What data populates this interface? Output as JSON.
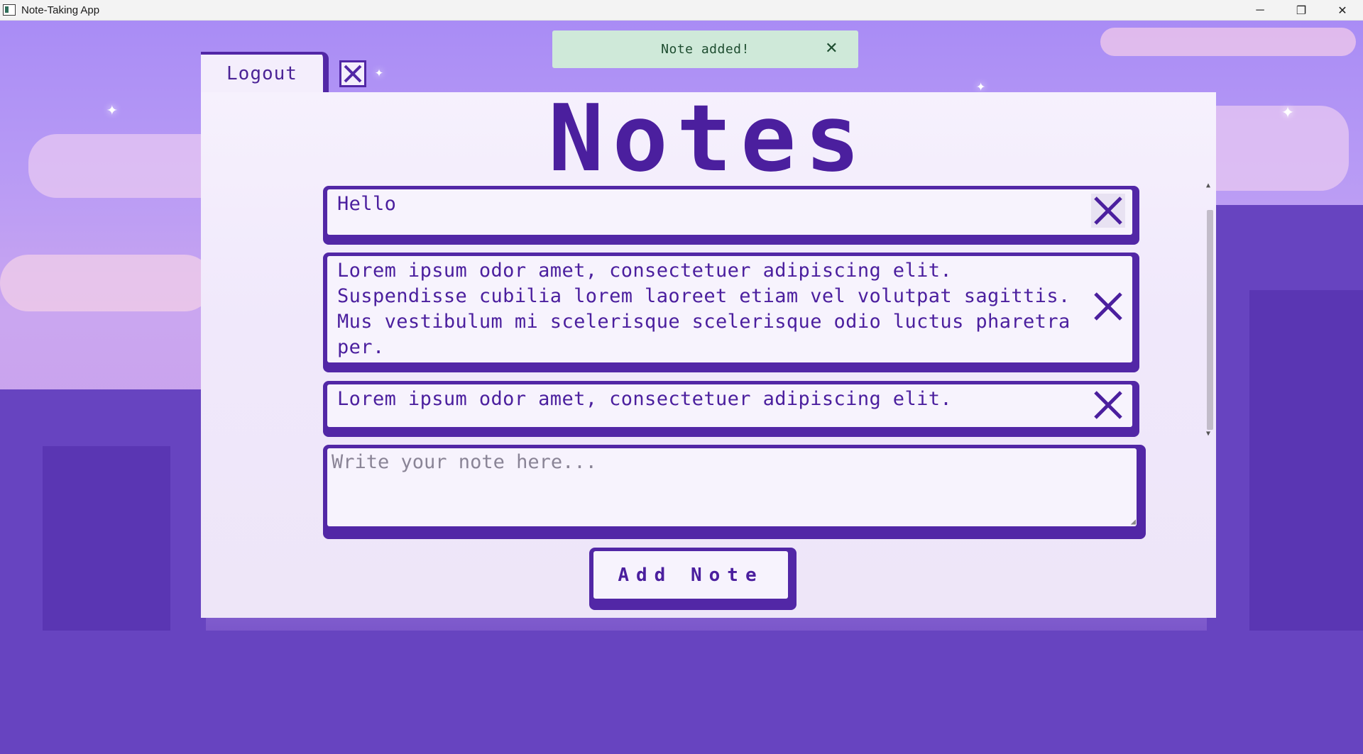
{
  "window": {
    "title": "Note-Taking App",
    "controls": {
      "minimize": "─",
      "restore": "❐",
      "close": "✕"
    }
  },
  "toast": {
    "message": "Note added!",
    "close_glyph": "✕"
  },
  "tabs": {
    "logout_label": "Logout"
  },
  "panel": {
    "title": "Notes"
  },
  "notes": [
    {
      "text": "Hello"
    },
    {
      "text": "Lorem ipsum odor amet, consectetuer adipiscing elit. Suspendisse cubilia lorem laoreet etiam vel volutpat sagittis. Mus vestibulum mi scelerisque scelerisque odio luctus pharetra per."
    },
    {
      "text": "Lorem ipsum odor amet, consectetuer adipiscing elit."
    }
  ],
  "composer": {
    "placeholder": "Write your note here...",
    "value": ""
  },
  "actions": {
    "add_label": "Add Note"
  },
  "colors": {
    "accent": "#5227a6",
    "text": "#4b1f9e",
    "card_bg": "#f7f3fd",
    "toast_bg": "#cfe9d9",
    "toast_text": "#1d4c2f"
  },
  "icons": {
    "app": "app-icon",
    "delete": "x-icon",
    "close_window": "x-box-icon"
  }
}
